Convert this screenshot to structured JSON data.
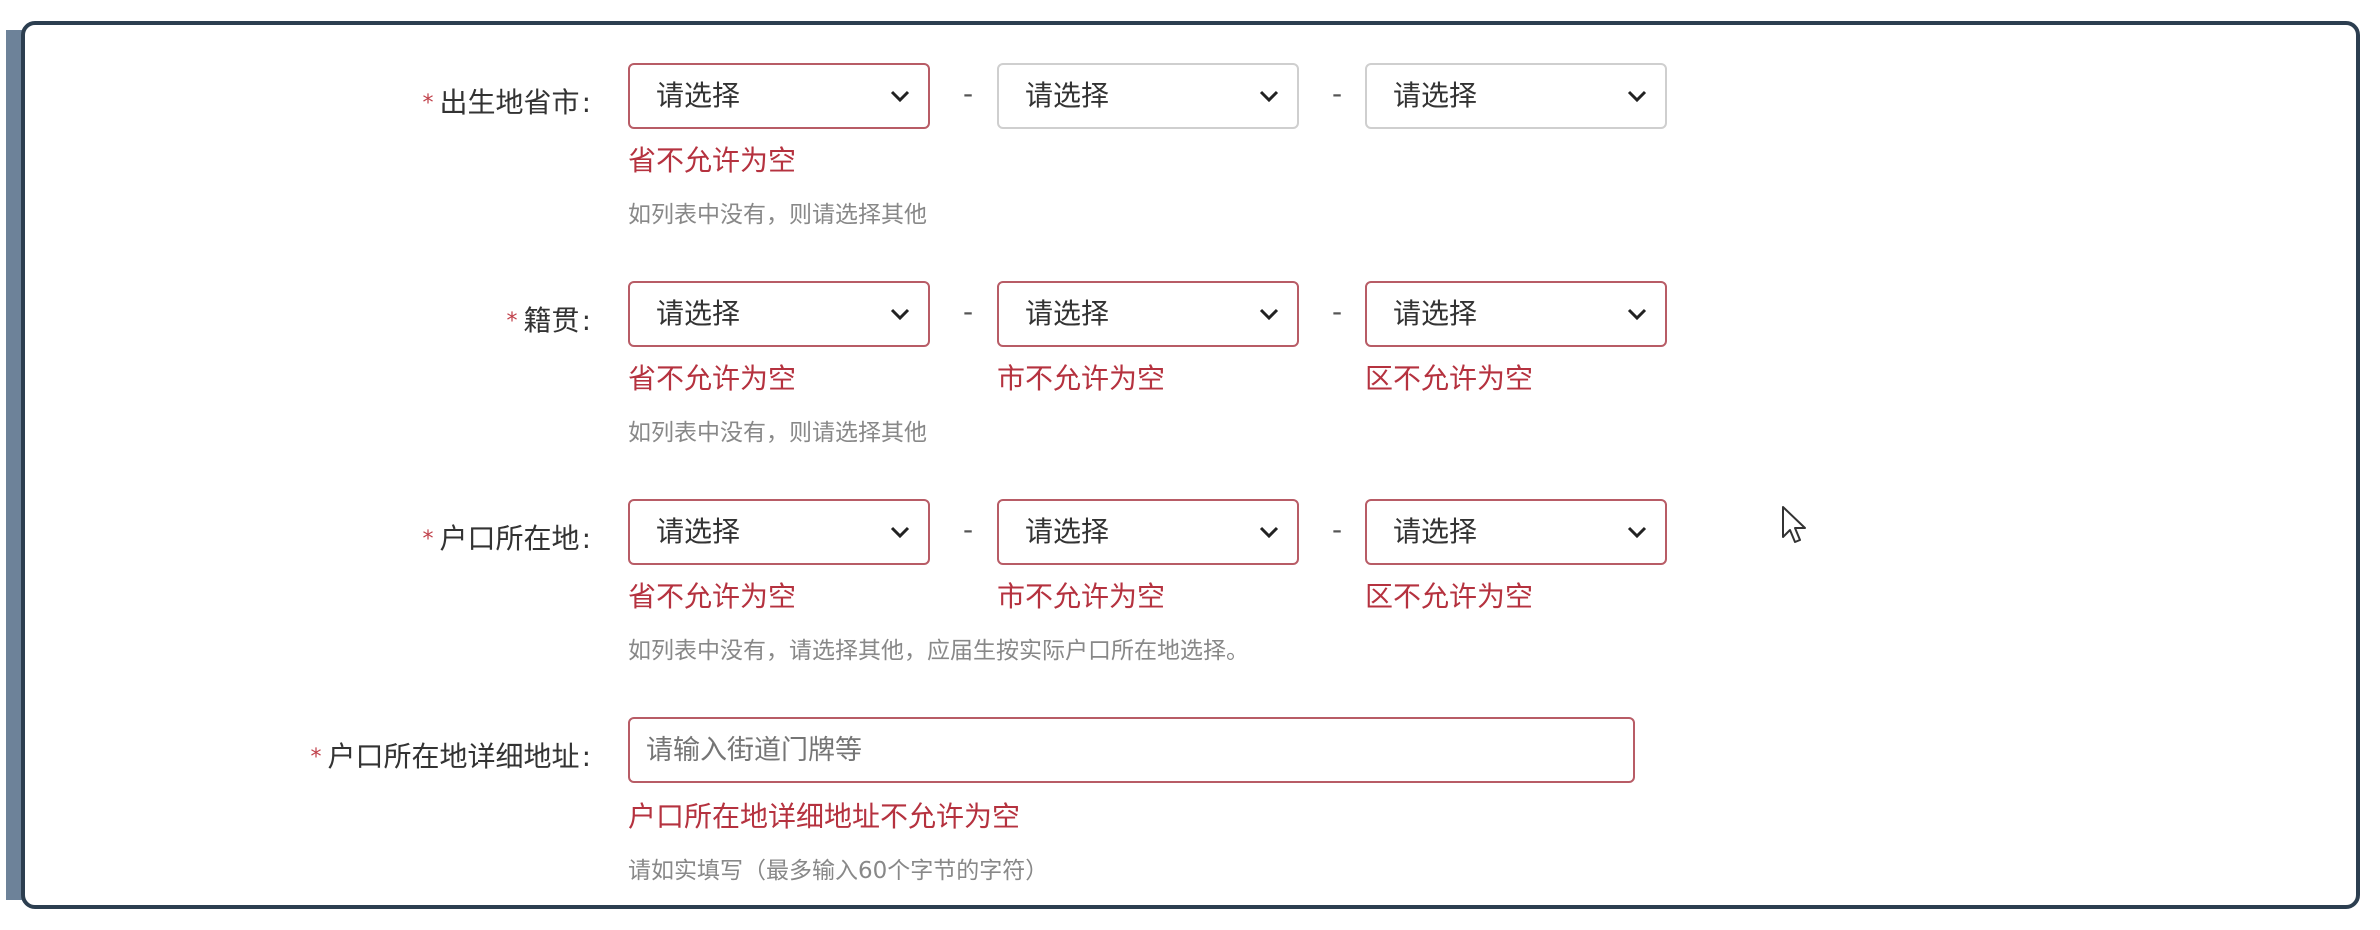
{
  "form": {
    "birthplace": {
      "required_mark": "*",
      "label": "出生地省市",
      "colon": ":",
      "select_values": [
        "请选择",
        "请选择",
        "请选择"
      ],
      "errors": [
        "省不允许为空",
        "",
        ""
      ],
      "hint": "如列表中没有，则请选择其他"
    },
    "native_place": {
      "required_mark": "*",
      "label": "籍贯",
      "colon": ":",
      "select_values": [
        "请选择",
        "请选择",
        "请选择"
      ],
      "errors": [
        "省不允许为空",
        "市不允许为空",
        "区不允许为空"
      ],
      "hint": "如列表中没有，则请选择其他"
    },
    "hukou": {
      "required_mark": "*",
      "label": "户口所在地",
      "colon": ":",
      "select_values": [
        "请选择",
        "请选择",
        "请选择"
      ],
      "errors": [
        "省不允许为空",
        "市不允许为空",
        "区不允许为空"
      ],
      "hint": "如列表中没有，请选择其他，应届生按实际户口所在地选择。"
    },
    "hukou_address": {
      "required_mark": "*",
      "label": "户口所在地详细地址",
      "colon": ":",
      "placeholder": "请输入街道门牌等",
      "value": "",
      "error": "户口所在地详细地址不允许为空",
      "hint": "请如实填写（最多输入60个字节的字符）"
    },
    "separator": "-"
  },
  "colors": {
    "error": "#b5323f",
    "invalid_border": "#b85c66",
    "frame_border": "#2c3e50",
    "hint": "#888888"
  },
  "icons": {
    "dropdown": "chevron-down-icon",
    "cursor": "mouse-pointer-icon"
  }
}
